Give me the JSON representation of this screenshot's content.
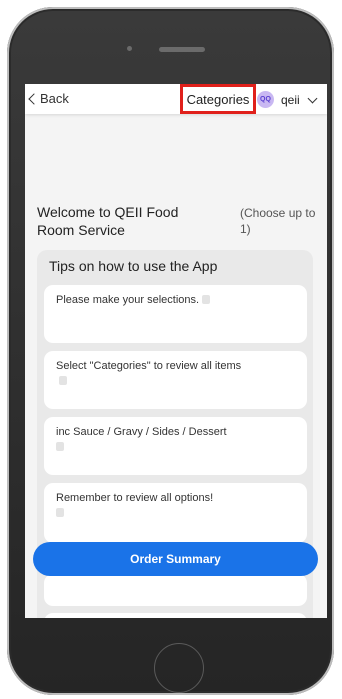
{
  "topbar": {
    "back_label": "Back",
    "categories_label": "Categories",
    "user": {
      "initials": "QQ",
      "name": "qeii"
    }
  },
  "header": {
    "welcome": "Welcome to QEII Food Room Service",
    "choose_note": "(Choose up to 1)"
  },
  "tips": {
    "title": "Tips on how to use the App",
    "items": [
      {
        "text": "Please make your selections."
      },
      {
        "text": "Select \"Categories\" to review all items"
      },
      {
        "text": "inc Sauce / Gravy / Sides / Dessert"
      },
      {
        "text": "Remember to review all options!"
      }
    ]
  },
  "order_summary_label": "Order Summary",
  "colors": {
    "accent": "#1a73e8",
    "highlight": "#e0201b",
    "avatar_bg": "#c9b8f2"
  }
}
